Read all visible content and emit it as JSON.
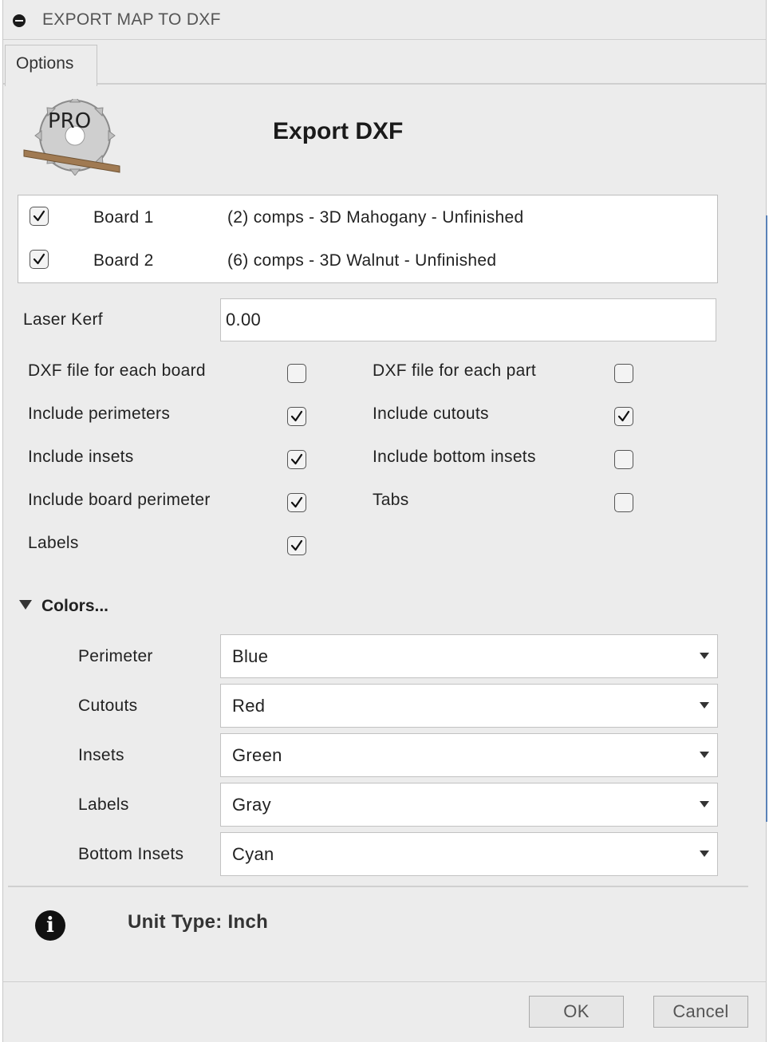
{
  "window": {
    "title": "EXPORT MAP TO DXF"
  },
  "tabs": [
    {
      "label": "Options"
    }
  ],
  "header": {
    "title": "Export DXF",
    "logo_text": "PRO"
  },
  "boards": [
    {
      "name": "Board 1",
      "description": "(2) comps - 3D Mahogany - Unfinished",
      "checked": true
    },
    {
      "name": "Board 2",
      "description": "(6) comps - 3D Walnut - Unfinished",
      "checked": true
    }
  ],
  "laser_kerf": {
    "label": "Laser Kerf",
    "value": "0.00"
  },
  "options_left": [
    {
      "label": "DXF file for each board",
      "checked": false
    },
    {
      "label": "Include perimeters",
      "checked": true
    },
    {
      "label": "Include insets",
      "checked": true
    },
    {
      "label": "Include board perimeter",
      "checked": true
    },
    {
      "label": "Labels",
      "checked": true
    }
  ],
  "options_right": [
    {
      "label": "DXF file for each part",
      "checked": false
    },
    {
      "label": "Include cutouts",
      "checked": true
    },
    {
      "label": "Include bottom insets",
      "checked": false
    },
    {
      "label": "Tabs",
      "checked": false
    }
  ],
  "colors": {
    "section_label": "Colors...",
    "rows": [
      {
        "label": "Perimeter",
        "value": "Blue"
      },
      {
        "label": "Cutouts",
        "value": "Red"
      },
      {
        "label": "Insets",
        "value": "Green"
      },
      {
        "label": "Labels",
        "value": "Gray"
      },
      {
        "label": "Bottom Insets",
        "value": "Cyan"
      }
    ]
  },
  "info": {
    "icon": "info-icon",
    "text": "Unit Type: Inch"
  },
  "buttons": {
    "ok": "OK",
    "cancel": "Cancel"
  }
}
